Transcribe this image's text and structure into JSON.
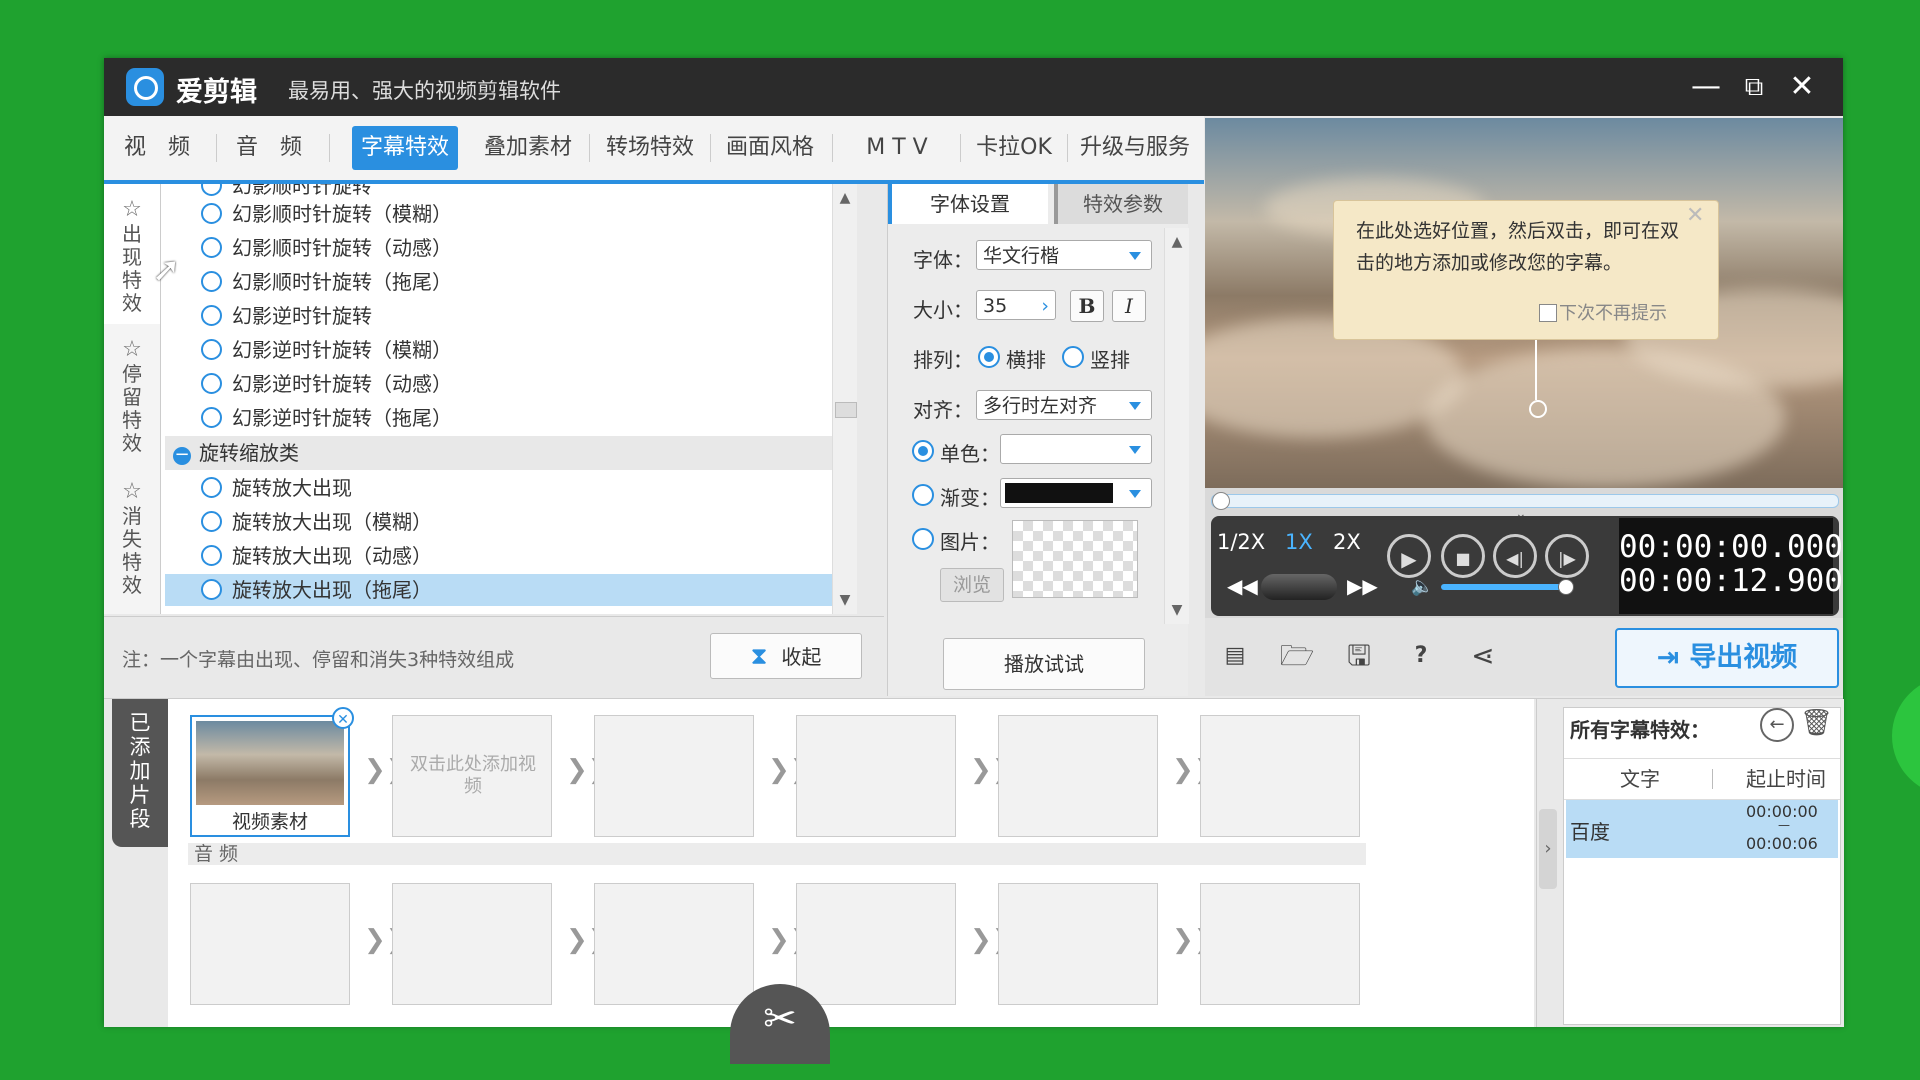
{
  "window": {
    "app_name": "爱剪辑",
    "slogan": "最易用、强大的视频剪辑软件",
    "minimize": "—",
    "maximize": "⧉",
    "close": "✕"
  },
  "tabs": [
    "视　频",
    "音　频",
    "字幕特效",
    "叠加素材",
    "转场特效",
    "画面风格",
    "M T V",
    "卡拉OK",
    "升级与服务"
  ],
  "active_tab": "字幕特效",
  "categories": [
    {
      "label": "出现特效",
      "icon": "star-icon"
    },
    {
      "label": "停留特效",
      "icon": "star-icon"
    },
    {
      "label": "消失特效",
      "icon": "star-icon"
    }
  ],
  "effect_list": {
    "top_partial": "幻影顺时针旋转",
    "items_a": [
      "幻影顺时针旋转（模糊）",
      "幻影顺时针旋转（动感）",
      "幻影顺时针旋转（拖尾）",
      "幻影逆时针旋转",
      "幻影逆时针旋转（模糊）",
      "幻影逆时针旋转（动感）",
      "幻影逆时针旋转（拖尾）"
    ],
    "group": "旋转缩放类",
    "items_b": [
      "旋转放大出现",
      "旋转放大出现（模糊）",
      "旋转放大出现（动感）",
      "旋转放大出现（拖尾）"
    ],
    "selected": "旋转放大出现（拖尾）"
  },
  "note": "注：一个字幕由出现、停留和消失3种特效组成",
  "collapse_button": "收起",
  "font_panel": {
    "tab_font": "字体设置",
    "tab_params": "特效参数",
    "font_label": "字体：",
    "font_value": "华文行楷",
    "size_label": "大小：",
    "size_value": "35",
    "bold": "B",
    "italic": "I",
    "layout_label": "排列：",
    "horizontal": "横排",
    "vertical": "竖排",
    "align_label": "对齐：",
    "align_value": "多行时左对齐",
    "solid_label": "单色：",
    "gradient_label": "渐变：",
    "image_label": "图片：",
    "browse": "浏览",
    "try_button": "播放试试",
    "gradient_color": "#111111"
  },
  "tooltip": {
    "text": "在此处选好位置，然后双击，即可在双击的地方添加或修改您的字幕。",
    "checkbox": "下次不再提示",
    "close": "✕"
  },
  "player": {
    "speeds": [
      "1/2X",
      "1X",
      "2X"
    ],
    "active_speed": "1X",
    "current_time": "00:00:00.000",
    "total_time": "00:00:12.900",
    "volume_level": 0.95
  },
  "export_button": "导出视频",
  "timeline": {
    "added_tab": "已添加片段",
    "clip_label": "视频素材",
    "empty_slot_hint": "双击此处添加视频",
    "audio_label": "音 频"
  },
  "fx_panel": {
    "title": "所有字幕特效：",
    "col_text": "文字",
    "col_time": "起止时间",
    "row_text": "百度",
    "row_start": "00:00:00",
    "row_dash": "—",
    "row_end": "00:00:06"
  },
  "colors": {
    "accent": "#2a8fe0",
    "background": "#1fa22f",
    "titlebar": "#2b2b2b",
    "selection": "#b9dcf5"
  }
}
